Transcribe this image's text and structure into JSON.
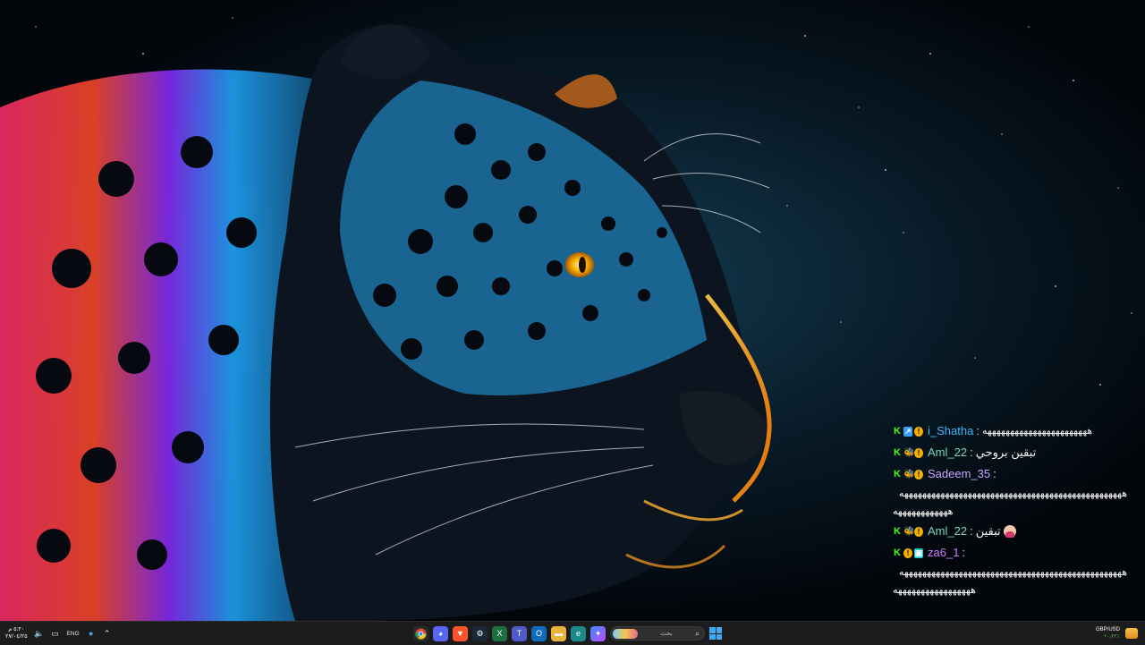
{
  "wallpaper": {
    "subject": "neon-jaguar-wallpaper"
  },
  "chat": {
    "messages": [
      {
        "user": "i_Shatha",
        "user_color": "#3db8ff",
        "text": "هههههههههههههههههههههههه",
        "badges": [
          "kick-badge",
          "verified-badge",
          "coin-badge"
        ],
        "continuation": []
      },
      {
        "user": "Aml_22",
        "user_color": "#7ad7b0",
        "text": "تبقين بروحي",
        "badges": [
          "kick-badge",
          "bee-badge",
          "coin-badge"
        ],
        "continuation": []
      },
      {
        "user": "Sadeem_35",
        "user_color": "#c9a6ff",
        "text": "",
        "badges": [
          "kick-badge",
          "bee-badge",
          "coin-badge"
        ],
        "continuation": [
          "هههههههههههههههههههههههههههههههههههههههههههههههههه",
          "ههههههههههههه"
        ]
      },
      {
        "user": "Aml_22",
        "user_color": "#7ad7b0",
        "text": "تبقين",
        "badges": [
          "kick-badge",
          "bee-badge",
          "coin-badge"
        ],
        "emoji": "girl-emoji",
        "continuation": []
      },
      {
        "user": "za6_1",
        "user_color": "#d07cff",
        "text": "",
        "badges": [
          "kick-badge",
          "coin-badge",
          "sub-badge"
        ],
        "continuation": [
          "هههههههههههههههههههههههههههههههههههههههههههههههههه",
          "هههههههههههههههههه"
        ]
      }
    ],
    "separator": ":"
  },
  "taskbar": {
    "clock_time": "٥:٢٠ م",
    "clock_date": "٢٧/٠٤/٢٥",
    "language": "ENG",
    "search_placeholder": "بحث",
    "fx_pair": "GBP/USD",
    "fx_change": "+٠٫٣٢٪",
    "pinned_apps": [
      "chrome-icon",
      "discord-icon",
      "brave-icon",
      "steam-icon",
      "excel-icon",
      "teams-icon",
      "outlook-icon",
      "file-explorer-icon",
      "edge-icon",
      "copilot-icon"
    ]
  }
}
